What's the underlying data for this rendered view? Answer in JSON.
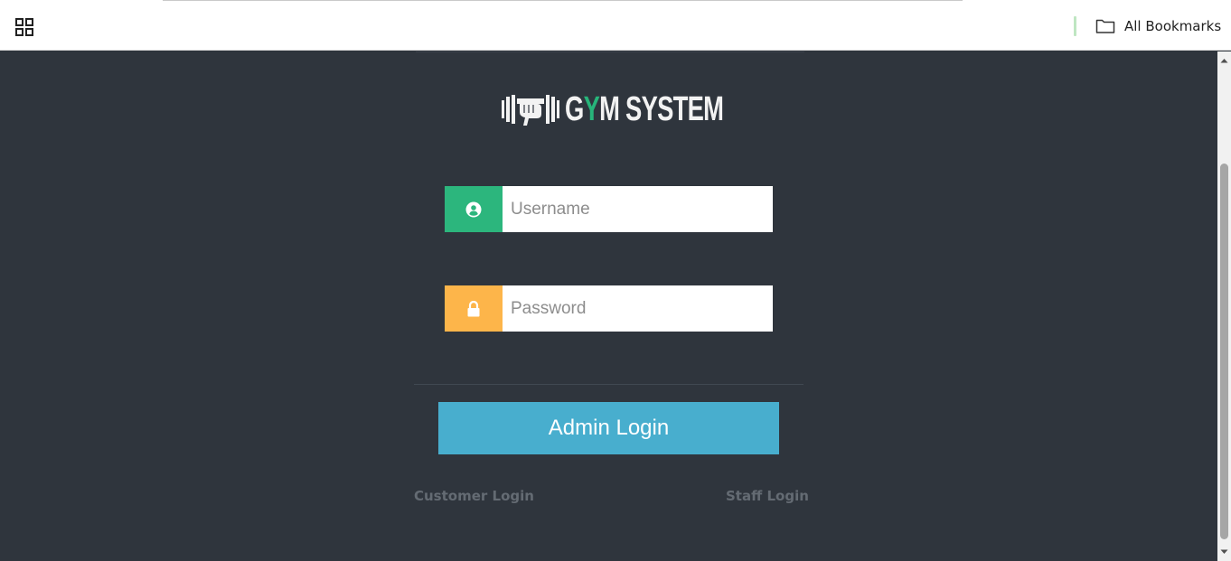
{
  "browser": {
    "bookmarks_bar": {
      "all_bookmarks_label": "All Bookmarks"
    }
  },
  "logo": {
    "text_before": "G",
    "text_accent": "Y",
    "text_after": "M SYSTEM"
  },
  "form": {
    "username": {
      "placeholder": "Username",
      "value": "",
      "icon": "user-circle-icon"
    },
    "password": {
      "placeholder": "Password",
      "value": "",
      "icon": "lock-icon"
    },
    "submit_label": "Admin Login"
  },
  "links": {
    "customer_login": "Customer Login",
    "staff_login": "Staff Login"
  },
  "colors": {
    "background": "#2f353d",
    "username_addon": "#2cb67d",
    "password_addon": "#fdb54a",
    "login_button": "#48aece",
    "logo_accent": "#27b57a",
    "link_text": "#646b73"
  }
}
